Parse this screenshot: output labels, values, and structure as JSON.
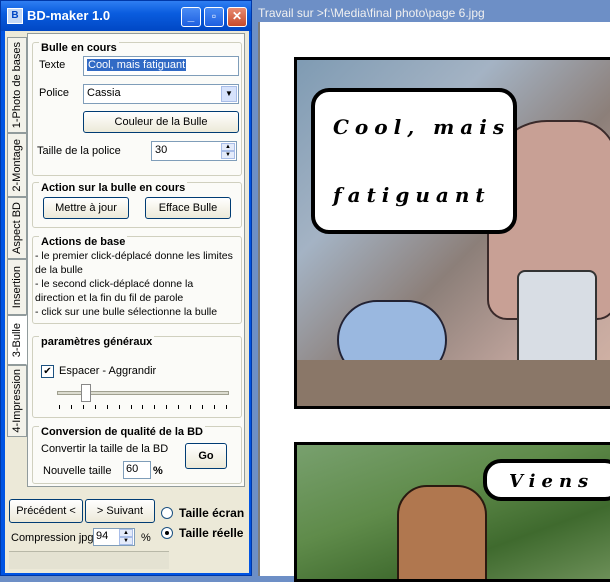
{
  "app": {
    "title": "BD-maker 1.0",
    "window_buttons": {
      "minimize": "_",
      "maximize": "▫",
      "close": "✕"
    }
  },
  "tabs": [
    {
      "label": "1-Photo de bases"
    },
    {
      "label": "2-Montage"
    },
    {
      "label": "Aspect BD"
    },
    {
      "label": "Insertion"
    },
    {
      "label": "3-Bulle",
      "active": true
    },
    {
      "label": "4-Impression"
    }
  ],
  "bulle": {
    "group_title": "Bulle en cours",
    "texte_label": "Texte",
    "texte_value": "Cool, mais fatiguant",
    "police_label": "Police",
    "police_value": "Cassia",
    "couleur_button": "Couleur de la Bulle",
    "taille_label": "Taille de la police",
    "taille_value": "30"
  },
  "action": {
    "group_title": "Action sur la bulle en cours",
    "update_button": "Mettre à jour",
    "erase_button": "Efface Bulle"
  },
  "base": {
    "group_title": "Actions de base",
    "lines": [
      "- le premier click-déplacé donne les limites",
      "de la bulle",
      "- le second click-déplacé donne la",
      "direction et la fin du  fil de parole",
      "- click sur une bulle sélectionne la bulle"
    ]
  },
  "params": {
    "group_title": "paramètres généraux",
    "checkbox_label": "Espacer - Aggrandir",
    "checkbox_checked": true,
    "slider_value_fraction": 0.15
  },
  "conversion": {
    "group_title": "Conversion de qualité de la BD",
    "convert_label": "Convertir la taille de la BD",
    "nouvelle_label": "Nouvelle taille",
    "nouvelle_value": "60",
    "percent": "%",
    "go_button": "Go"
  },
  "bottom": {
    "prev_button": "Précédent <",
    "next_button": "> Suivant",
    "taille_ecran": "Taille écran",
    "taille_reelle": "Taille réelle",
    "compression_label": "Compression jpg",
    "compression_value": "94",
    "percent": "%"
  },
  "viewer": {
    "title": "Travail sur  >f:\\Media\\final photo\\page 6.jpg",
    "bubble1_line1": "Cool, mais",
    "bubble1_line2": "fatiguant",
    "bubble2_text": "Viens"
  }
}
